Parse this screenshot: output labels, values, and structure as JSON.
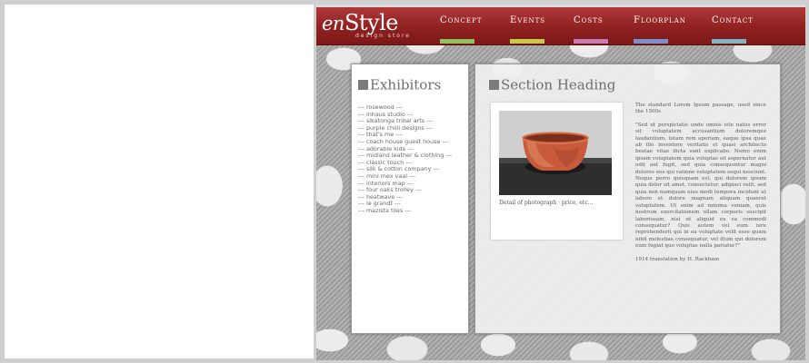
{
  "logo": {
    "main_prefix": "en",
    "main_suffix": "Style",
    "sub": "design store"
  },
  "nav": [
    {
      "label": "Concept",
      "color": "#8fbf5f"
    },
    {
      "label": "Events",
      "color": "#c8c94a"
    },
    {
      "label": "Costs",
      "color": "#c77bb5"
    },
    {
      "label": "Floorplan",
      "color": "#7f8fc9"
    },
    {
      "label": "Contact",
      "color": "#7fb6c7"
    }
  ],
  "exhibitors": {
    "heading": "Exhibitors",
    "items": [
      "--- rosewood ---",
      "--- inhaus studio ---",
      "--- sikatonga tribal arts ---",
      "--- purple chilli designs ---",
      "--- that's me ---",
      "--- coach house guest house ---",
      "--- adorable kids ---",
      "--- midland leather & clothing ---",
      "--- classic touch ---",
      "--- silk & cotton company ---",
      "--- mini mex vaal ---",
      "--- interiors map ---",
      "--- four oaks trolley ---",
      "--- heatwave ---",
      "--- le grandt ---",
      "--- mazista tiles ---"
    ]
  },
  "main": {
    "heading": "Section Heading",
    "photo_caption": "Detail of photograph · price, etc...",
    "paragraphs": [
      "The standard Lorem Ipsum passage, used since the 1500s",
      "\"Sed ut perspiciatis unde omnis iste natus error sit voluptatem accusantium doloremque laudantium, totam rem aperiam, eaque ipsa quae ab illo inventore veritatis et quasi architecto beatae vitae dicta sunt explicabo. Nemo enim ipsam voluptatem quia voluptas sit aspernatur aut odit aut fugit, sed quia consequuntur magni dolores eos qui ratione voluptatem sequi nesciunt. Neque porro quisquam est, qui dolorem ipsum quia dolor sit amet, consectetur, adipisci velit, sed quia non numquam eius modi tempora incidunt ut labore et dolore magnam aliquam quaerat voluptatem. Ut enim ad minima veniam, quis nostrum exercitationem ullam corporis suscipit laboriosam, nisi ut aliquid ex ea commodi consequatur? Quis autem vel eum iure reprehenderit qui in ea voluptate velit esse quam nihil molestiae consequatur, vel illum qui dolorem eum fugiat quo voluptas nulla pariatur?\"",
      "1914 translation by H. Rackham"
    ]
  }
}
